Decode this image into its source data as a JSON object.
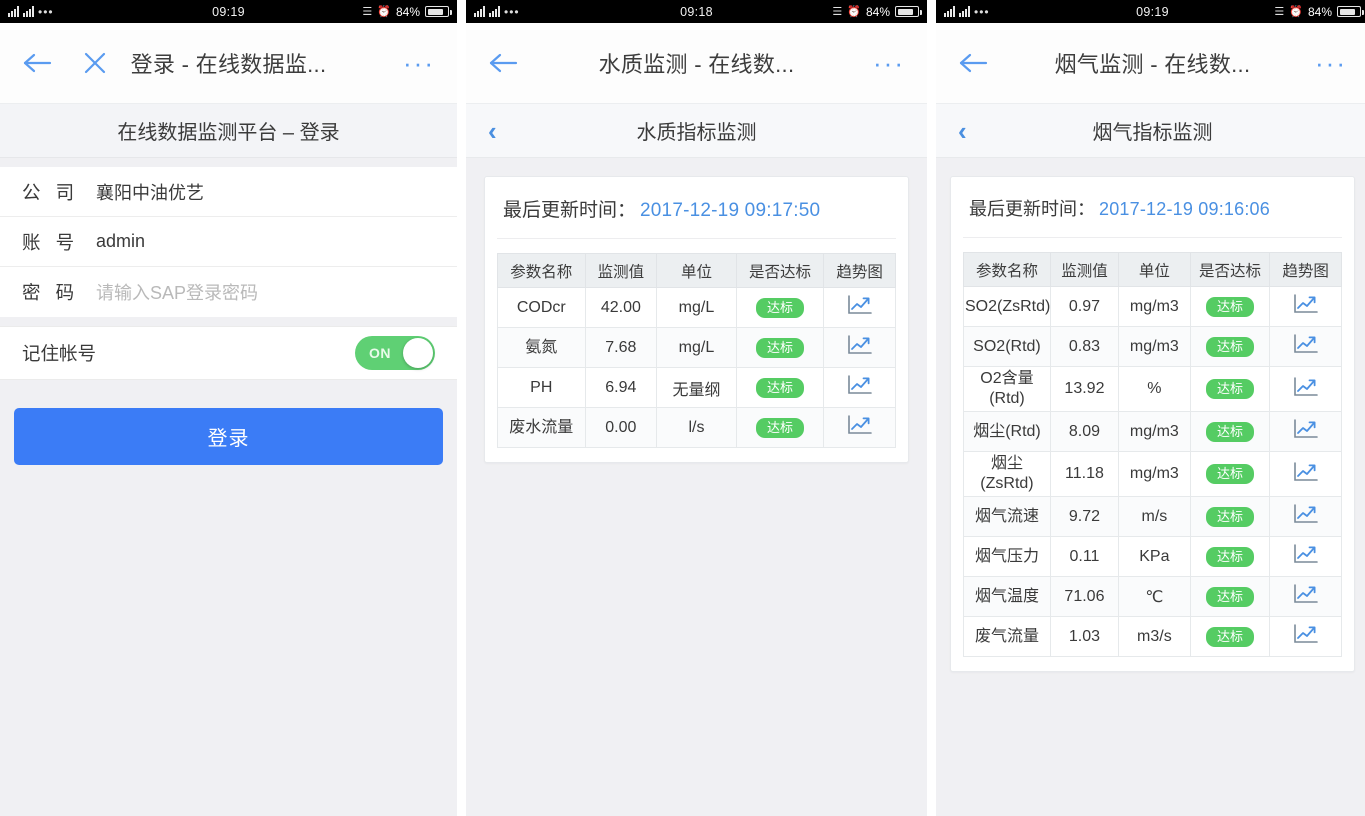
{
  "statusbar": {
    "carrier_dots": "•••",
    "time_login": "09:19",
    "time_water": "09:18",
    "time_flue": "09:19",
    "battery": "84%"
  },
  "login_screen": {
    "chrome": {
      "title": "登录 - 在线数据监...",
      "back_icon": "arrow-left-icon",
      "close_icon": "close-icon",
      "menu": "···"
    },
    "page_title": "在线数据监测平台 – 登录",
    "fields": [
      {
        "label": "公 司",
        "value": "襄阳中油优艺",
        "is_placeholder": false
      },
      {
        "label": "账 号",
        "value": "admin",
        "is_placeholder": false
      },
      {
        "label": "密 码",
        "value": "请输入SAP登录密码",
        "is_placeholder": true
      }
    ],
    "remember": {
      "label": "记住帐号",
      "state": "ON",
      "on": true
    },
    "login_button": "登录",
    "accent_color": "#3b7cf6",
    "switch_color": "#5fd074"
  },
  "water_screen": {
    "chrome": {
      "title": "水质监测 - 在线数...",
      "menu": "···"
    },
    "appbar": {
      "title": "水质指标监测",
      "back_icon": "chevron-left-icon"
    },
    "update_label": "最后更新时间：",
    "update_time": "2017-12-19 09:17:50",
    "table": {
      "headers": [
        "参数名称",
        "监测值",
        "单位",
        "是否达标",
        "趋势图"
      ],
      "rows": [
        {
          "name": "CODcr",
          "value": "42.00",
          "unit": "mg/L",
          "status": "达标",
          "trend": "trend-chart-icon"
        },
        {
          "name": "氨氮",
          "value": "7.68",
          "unit": "mg/L",
          "status": "达标",
          "trend": "trend-chart-icon"
        },
        {
          "name": "PH",
          "value": "6.94",
          "unit": "无量纲",
          "status": "达标",
          "trend": "trend-chart-icon"
        },
        {
          "name": "废水流量",
          "value": "0.00",
          "unit": "l/s",
          "status": "达标",
          "trend": "trend-chart-icon"
        }
      ]
    }
  },
  "flue_screen": {
    "chrome": {
      "title": "烟气监测 - 在线数...",
      "menu": "···"
    },
    "appbar": {
      "title": "烟气指标监测",
      "back_icon": "chevron-left-icon"
    },
    "update_label": "最后更新时间：",
    "update_time": "2017-12-19 09:16:06",
    "table": {
      "headers": [
        "参数名称",
        "监测值",
        "单位",
        "是否达标",
        "趋势图"
      ],
      "rows": [
        {
          "name": "SO2(ZsRtd)",
          "value": "0.97",
          "unit": "mg/m3",
          "status": "达标",
          "trend": "trend-chart-icon"
        },
        {
          "name": "SO2(Rtd)",
          "value": "0.83",
          "unit": "mg/m3",
          "status": "达标",
          "trend": "trend-chart-icon"
        },
        {
          "name": "O2含量\n(Rtd)",
          "value": "13.92",
          "unit": "%",
          "status": "达标",
          "trend": "trend-chart-icon"
        },
        {
          "name": "烟尘(Rtd)",
          "value": "8.09",
          "unit": "mg/m3",
          "status": "达标",
          "trend": "trend-chart-icon"
        },
        {
          "name": "烟尘\n(ZsRtd)",
          "value": "11.18",
          "unit": "mg/m3",
          "status": "达标",
          "trend": "trend-chart-icon"
        },
        {
          "name": "烟气流速",
          "value": "9.72",
          "unit": "m/s",
          "status": "达标",
          "trend": "trend-chart-icon"
        },
        {
          "name": "烟气压力",
          "value": "0.11",
          "unit": "KPa",
          "status": "达标",
          "trend": "trend-chart-icon"
        },
        {
          "name": "烟气温度",
          "value": "71.06",
          "unit": "℃",
          "status": "达标",
          "trend": "trend-chart-icon"
        },
        {
          "name": "废气流量",
          "value": "1.03",
          "unit": "m3/s",
          "status": "达标",
          "trend": "trend-chart-icon"
        }
      ]
    }
  },
  "colors": {
    "accent_blue": "#3b7cf6",
    "link_blue": "#4a90e2",
    "status_green": "#55cc63",
    "page_bg": "#f0f0f3"
  }
}
